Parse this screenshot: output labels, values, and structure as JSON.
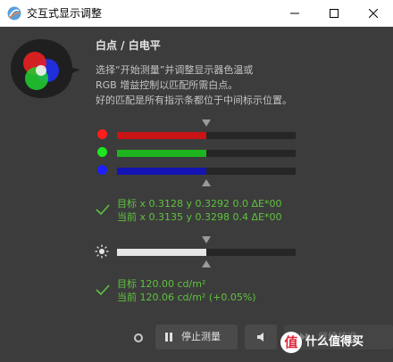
{
  "window": {
    "title": "交互式显示调整",
    "icons": {
      "app": "display-calibration-app-icon",
      "minimize": "minimize-icon",
      "maximize": "maximize-icon",
      "close": "close-icon"
    }
  },
  "section": {
    "title": "白点 / 白电平",
    "description": [
      "选择“开始测量”并调整显示器色温或",
      "RGB 增益控制以匹配所需白点。",
      "好的匹配是所有指示条都位于中间标示位置。"
    ]
  },
  "rgb_bars": [
    {
      "channel": "red",
      "color": "#ff1e1e",
      "fill_color": "#c81414",
      "level": 0.5
    },
    {
      "channel": "green",
      "color": "#1ee61e",
      "fill_color": "#1eb41e",
      "level": 0.5
    },
    {
      "channel": "blue",
      "color": "#1e1eff",
      "fill_color": "#1414b4",
      "level": 0.5
    }
  ],
  "white_point": {
    "target": "目标 x 0.3128 y 0.3292 0.0 ΔE*00",
    "current": "当前 x 0.3135 y 0.3298 0.4 ΔE*00"
  },
  "luminance_bar": {
    "level": 0.5,
    "fill_color": "#e6e6e6",
    "icon": "brightness-sun-icon"
  },
  "luminance": {
    "target": "目标 120.00 cd/m²",
    "current": "当前 120.06 cd/m² (+0.05%)"
  },
  "buttons": {
    "pause_label": "停止测量",
    "continue_label": "继续校准"
  },
  "watermark": {
    "badge": "值",
    "text": "什么值得买"
  },
  "colors": {
    "background": "#3c3c3c",
    "success": "#5ec33c",
    "track": "#262626"
  }
}
